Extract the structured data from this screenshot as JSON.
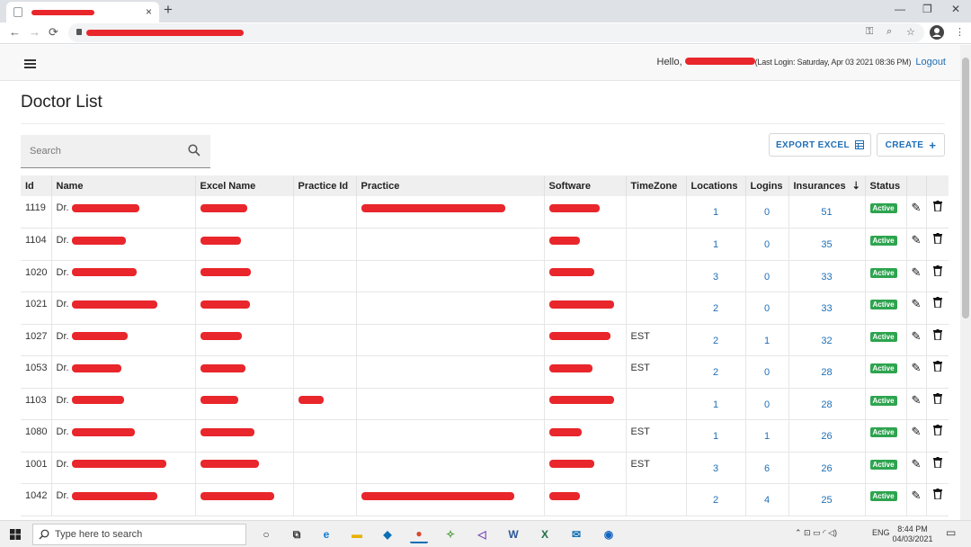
{
  "browser": {
    "tab_close": "×",
    "new_tab": "+",
    "window_controls": [
      "—",
      "❐",
      "✕"
    ],
    "nav": [
      "←",
      "→",
      "⟳"
    ],
    "omnibox_icons": [
      "⚿",
      "⌕",
      "☆",
      "⋮"
    ]
  },
  "header": {
    "hello_prefix": "Hello,",
    "last_login": "(Last Login: Saturday, Apr 03 2021 08:36 PM)",
    "logout": "Logout"
  },
  "page": {
    "title": "Doctor List",
    "search_placeholder": "Search",
    "export_label": "EXPORT EXCEL",
    "create_label": "CREATE",
    "create_icon": "+"
  },
  "table": {
    "columns": [
      "Id",
      "Name",
      "Excel Name",
      "Practice Id",
      "Practice",
      "Software",
      "TimeZone",
      "Locations",
      "Logins",
      "Insurances",
      "Status",
      "",
      ""
    ],
    "sort_icon": "⇣",
    "rows": [
      {
        "id": "1119",
        "name": "Dr.",
        "timezone": "",
        "locations": "1",
        "logins": "0",
        "insurances": "51",
        "status": "Active"
      },
      {
        "id": "1104",
        "name": "Dr.",
        "timezone": "",
        "locations": "1",
        "logins": "0",
        "insurances": "35",
        "status": "Active"
      },
      {
        "id": "1020",
        "name": "Dr.",
        "timezone": "",
        "locations": "3",
        "logins": "0",
        "insurances": "33",
        "status": "Active"
      },
      {
        "id": "1021",
        "name": "Dr.",
        "timezone": "",
        "locations": "2",
        "logins": "0",
        "insurances": "33",
        "status": "Active"
      },
      {
        "id": "1027",
        "name": "Dr.",
        "timezone": "EST",
        "locations": "2",
        "logins": "1",
        "insurances": "32",
        "status": "Active"
      },
      {
        "id": "1053",
        "name": "Dr.",
        "timezone": "EST",
        "locations": "2",
        "logins": "0",
        "insurances": "28",
        "status": "Active"
      },
      {
        "id": "1103",
        "name": "Dr.",
        "timezone": "",
        "locations": "1",
        "logins": "0",
        "insurances": "28",
        "status": "Active"
      },
      {
        "id": "1080",
        "name": "Dr.",
        "timezone": "EST",
        "locations": "1",
        "logins": "1",
        "insurances": "26",
        "status": "Active"
      },
      {
        "id": "1001",
        "name": "Dr.",
        "timezone": "EST",
        "locations": "3",
        "logins": "6",
        "insurances": "26",
        "status": "Active"
      },
      {
        "id": "1042",
        "name": "Dr.",
        "timezone": "",
        "locations": "2",
        "logins": "4",
        "insurances": "25",
        "status": "Active"
      }
    ],
    "edit_icon": "✎",
    "delete_icon": "🗑"
  },
  "taskbar": {
    "start_icon": "windows-logo",
    "search_placeholder": "Type here to search",
    "app_icons": [
      "cortana-icon",
      "task-view-icon",
      "edge-icon",
      "file-explorer-icon",
      "dell-icon",
      "chrome-icon",
      "app-icon",
      "visual-studio-icon",
      "word-icon",
      "excel-icon",
      "mail-icon",
      "app-icon-2"
    ],
    "app_glyphs": [
      "○",
      "⧉",
      "e",
      "▬",
      "◆",
      "●",
      "✧",
      "◁",
      "W",
      "X",
      "✉",
      "◉"
    ],
    "tray_lang": "ENG",
    "tray_glyphs": "⌃ ⊡ ▭ ◜ ◁)",
    "time": "8:44 PM",
    "date": "04/03/2021",
    "notification_glyph": "▭"
  },
  "colors": {
    "accent": "#1f6fb7",
    "active_badge": "#2ea44f",
    "redaction": "#e8262b",
    "header_bg": "#f8f8f8",
    "table_header_bg": "#efefef"
  }
}
